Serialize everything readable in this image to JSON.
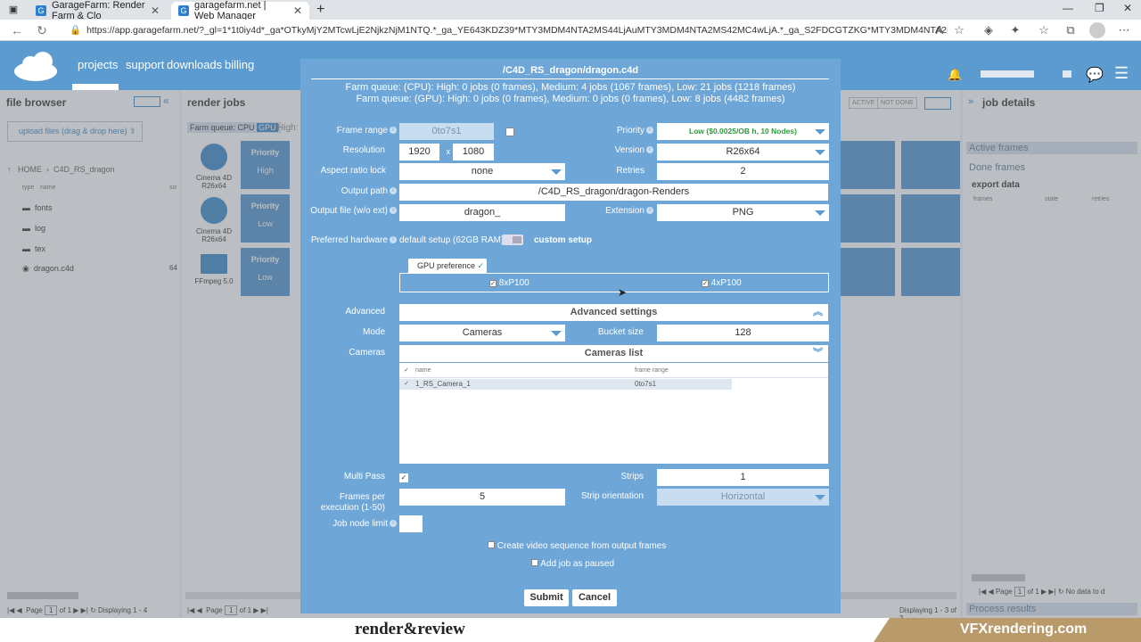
{
  "browser": {
    "tabs": [
      {
        "label": "GarageFarm: Render Farm & Clo"
      },
      {
        "label": "garagefarm.net | Web Manager"
      }
    ],
    "url": "https://app.garagefarm.net/?_gl=1*1t0iy4d*_ga*OTkyMjY2MTcwLjE2NjkzNjM1NTQ.*_ga_YE643KDZ39*MTY3MDM4NTA2MS44LjAuMTY3MDM4NTA2MS42MC4wLjA.*_ga_S2FDCGTZKG*MTY3MDM4NTA2MS44LjEuMTY3MDM4NT..."
  },
  "app": {
    "nav": [
      "projects",
      "support",
      "downloads",
      "billing"
    ]
  },
  "file_browser": {
    "title": "file browser",
    "upload_label": "upload files (drag & drop here)",
    "breadcrumb": [
      "HOME",
      "C4D_RS_dragon"
    ],
    "col_type": "type",
    "col_name": "name",
    "col_size": "siz",
    "items": [
      {
        "name": "fonts"
      },
      {
        "name": "log"
      },
      {
        "name": "tex"
      },
      {
        "name": "dragon.c4d",
        "size": "64"
      }
    ],
    "footer_page": "Page",
    "footer_page_num": "1",
    "footer_of": "of 1",
    "footer_display": "Displaying 1 - 4"
  },
  "render_jobs": {
    "title": "render jobs",
    "farm_queue": "Farm queue:",
    "cpu": "CPU",
    "gpu": "GPU",
    "high": "High:",
    "filters": [
      "ACTIVE",
      "NOT DONE"
    ],
    "jobs": [
      {
        "app": "Cinema 4D R26x64",
        "priority_label": "Priority",
        "priority": "High"
      },
      {
        "app": "Cinema 4D R26x64",
        "priority_label": "Priority",
        "priority": "Low"
      },
      {
        "app": "FFmpeg 5.0",
        "priority_label": "Priority",
        "priority": "Low"
      }
    ],
    "footer_page": "Page",
    "footer_page_num": "1",
    "footer_of": "of 1",
    "footer_display": "Displaying 1 - 3 of 3"
  },
  "job_details": {
    "title": "job details",
    "active_frames": "Active frames",
    "done_frames": "Done frames",
    "export_data": "export data",
    "cols": [
      "frames",
      "state",
      "retries"
    ],
    "footer_page": "Page",
    "footer_page_num": "1",
    "footer_of": "of 1",
    "no_data": "No data to d",
    "process_results": "Process results"
  },
  "modal": {
    "title": "/C4D_RS_dragon/dragon.c4d",
    "queue_cpu": "Farm queue: (CPU): High: 0 jobs (0 frames), Medium: 4 jobs (1067 frames), Low: 21 jobs (1218 frames)",
    "queue_gpu": "Farm queue: (GPU): High: 0 jobs (0 frames), Medium: 0 jobs (0 frames), Low: 8 jobs (4482 frames)",
    "frame_range_label": "Frame range",
    "frame_range": "0to7s1",
    "resolution_label": "Resolution",
    "res_w": "1920",
    "res_x": "x",
    "res_h": "1080",
    "aspect_label": "Aspect ratio lock",
    "aspect": "none",
    "output_path_label": "Output path",
    "output_path": "/C4D_RS_dragon/dragon-Renders",
    "output_file_label": "Output file (w/o ext)",
    "output_file": "dragon_",
    "priority_label": "Priority",
    "priority": "Low ($0.0025/OB h, 10 Nodes)",
    "version_label": "Version",
    "version": "R26x64",
    "retries_label": "Retries",
    "retries": "2",
    "extension_label": "Extension",
    "extension": "PNG",
    "hardware_label": "Preferred hardware",
    "hardware_default": "default setup (62GB RAM)",
    "hardware_custom": "custom setup",
    "gpu_pref": "GPU preference",
    "gpu1": "8xP100",
    "gpu2": "4xP100",
    "advanced_label": "Advanced",
    "advanced_settings": "Advanced settings",
    "mode_label": "Mode",
    "mode": "Cameras",
    "bucket_label": "Bucket size",
    "bucket": "128",
    "cameras_label": "Cameras",
    "cameras_list": "Cameras list",
    "cam_col_name": "name",
    "cam_col_range": "frame range",
    "cameras": [
      {
        "name": "1_RS_Camera_1",
        "range": "0to7s1"
      }
    ],
    "multipass_label": "Multi Pass",
    "strips_label": "Strips",
    "strips": "1",
    "fpe_label": "Frames per execution (1-50)",
    "fpe": "5",
    "strip_orient_label": "Strip orientation",
    "strip_orient": "Horizontal",
    "node_limit_label": "Job node limit",
    "video_seq": "Create video sequence from output frames",
    "paused": "Add job as paused",
    "submit": "Submit",
    "cancel": "Cancel"
  },
  "banner": {
    "left": "render&review",
    "right": "VFXrendering.com"
  }
}
